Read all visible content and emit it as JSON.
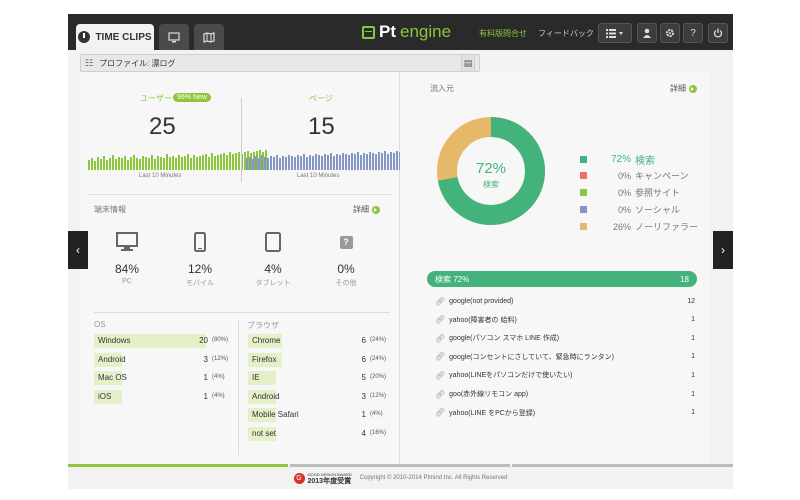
{
  "header": {
    "tabs": [
      {
        "label": "TIME CLIPS",
        "icon": "clock-icon",
        "active": true
      },
      {
        "icon": "monitor-icon",
        "active": false
      },
      {
        "icon": "map-icon",
        "active": false
      }
    ],
    "logo_pt": "Pt",
    "logo_engine": "engine",
    "trial_link": "有料版問合せ",
    "feedback_link": "フィードバック",
    "menu_icon": "list-icon",
    "user_icon": "user-icon",
    "settings_icon": "gear-icon",
    "help_label": "?",
    "power_icon": "power-icon"
  },
  "breadcrumb": {
    "text": "プロファイル: 漂ログ"
  },
  "visitors": {
    "users_label": "ユーザー",
    "users_badge": "96% New",
    "users_value": "25",
    "pages_label": "ページ",
    "pages_value": "15",
    "spark_caption": "Last 10 Minutes",
    "user_spark": [
      10,
      12,
      9,
      13,
      11,
      14,
      10,
      12,
      15,
      11,
      13,
      12,
      14,
      10,
      13,
      15,
      12,
      11,
      14,
      13,
      12,
      15,
      11,
      14,
      13,
      12,
      16,
      13,
      14,
      12,
      15,
      13,
      14,
      16,
      12,
      15,
      13,
      14,
      15,
      16,
      13,
      17,
      14,
      15,
      16,
      17,
      15,
      18,
      16,
      17,
      18,
      16,
      18,
      19,
      17,
      18,
      19,
      20,
      18,
      20
    ],
    "page_spark": [
      12,
      13,
      11,
      14,
      12,
      15,
      13,
      12,
      14,
      13,
      15,
      12,
      14,
      13,
      15,
      14,
      13,
      15,
      14,
      16,
      13,
      15,
      14,
      16,
      15,
      14,
      16,
      15,
      17,
      14,
      16,
      15,
      17,
      16,
      15,
      17,
      16,
      18,
      15,
      17,
      16,
      18,
      17,
      16,
      18,
      17,
      19,
      16,
      18,
      17,
      19,
      18,
      17,
      19,
      18,
      20,
      19,
      18,
      20,
      19
    ],
    "user_color": "#8cc63f",
    "page_color": "#8497c4"
  },
  "devices": {
    "title": "端末情報",
    "detail_label": "詳細",
    "items": [
      {
        "icon": "desktop-icon",
        "pct": "84%",
        "name": "PC"
      },
      {
        "icon": "mobile-icon",
        "pct": "12%",
        "name": "モバイル"
      },
      {
        "icon": "tablet-icon",
        "pct": "4%",
        "name": "タブレット"
      },
      {
        "icon": "question-icon",
        "pct": "0%",
        "name": "その他",
        "glyph": "?"
      }
    ]
  },
  "os": {
    "title": "OS",
    "rows": [
      {
        "name": "Windows",
        "count": "20",
        "pct": "(80%)",
        "share": 0.8
      },
      {
        "name": "Android",
        "count": "3",
        "pct": "(12%)",
        "share": 0.12
      },
      {
        "name": "Mac OS",
        "count": "1",
        "pct": "(4%)",
        "share": 0.04
      },
      {
        "name": "iOS",
        "count": "1",
        "pct": "(4%)",
        "share": 0.04
      }
    ]
  },
  "browser": {
    "title": "ブラウザ",
    "rows": [
      {
        "name": "Chrome",
        "count": "6",
        "pct": "(24%)",
        "share": 0.24
      },
      {
        "name": "Firefox",
        "count": "6",
        "pct": "(24%)",
        "share": 0.24
      },
      {
        "name": "IE",
        "count": "5",
        "pct": "(20%)",
        "share": 0.2
      },
      {
        "name": "Android",
        "count": "3",
        "pct": "(12%)",
        "share": 0.12
      },
      {
        "name": "Mobile Safari",
        "count": "1",
        "pct": "(4%)",
        "share": 0.04
      },
      {
        "name": "not set",
        "count": "4",
        "pct": "(16%)",
        "share": 0.16
      }
    ]
  },
  "referrer": {
    "title": "流入元",
    "detail_label": "詳細",
    "donut_pct": "72%",
    "donut_label": "検索",
    "legend": [
      {
        "pct": "72%",
        "label": "検索",
        "color": "#43b37b",
        "share": 0.72,
        "highlight": true
      },
      {
        "pct": "0%",
        "label": "キャンペーン",
        "color": "#f0706a",
        "share": 0.0
      },
      {
        "pct": "0%",
        "label": "参照サイト",
        "color": "#8cc63f",
        "share": 0.0
      },
      {
        "pct": "0%",
        "label": "ソーシャル",
        "color": "#8497c4",
        "share": 0.0
      },
      {
        "pct": "26%",
        "label": "ノーリファラー",
        "color": "#e6b96a",
        "share": 0.26
      }
    ],
    "selected_label": "検索 72%",
    "selected_count": "18",
    "keywords": [
      {
        "text": "google(not provided)",
        "count": "12"
      },
      {
        "text": "yahoo(障害者の 給料)",
        "count": "1"
      },
      {
        "text": "google(パソコン スマホ LINE 作成)",
        "count": "1"
      },
      {
        "text": "google(コンセントにさしていて、緊急時にランタン)",
        "count": "1"
      },
      {
        "text": "yahoo(LINEをパソコンだけで使いたい)",
        "count": "1"
      },
      {
        "text": "goo(赤外線リモコン app)",
        "count": "1"
      },
      {
        "text": "yahoo(LINE をPCから登録)",
        "count": "1"
      }
    ]
  },
  "footer": {
    "award_top": "GOOD DESIGN AWARD",
    "award_main": "2013年度受賞",
    "copyright": "Copyright © 2010-2014 Ptmind Inc. All Rights Reserved"
  },
  "colors": {
    "accent": "#8cc63f",
    "search_green": "#43b37b",
    "dark_bar": "#2a2a2a"
  }
}
